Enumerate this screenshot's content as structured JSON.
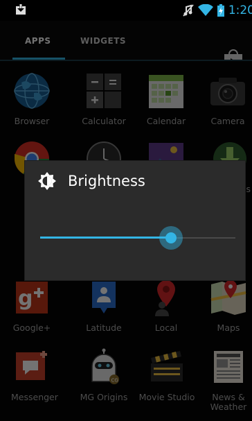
{
  "status_bar": {
    "time": "1:20",
    "icons": [
      "download-icon",
      "mute-icon",
      "wifi-icon",
      "battery-charging-icon"
    ]
  },
  "tabs": {
    "apps": "APPS",
    "widgets": "WIDGETS",
    "store_icon": "play-store-icon"
  },
  "apps": [
    {
      "label": "Browser"
    },
    {
      "label": "Calculator"
    },
    {
      "label": "Calendar"
    },
    {
      "label": "Camera"
    },
    {
      "label": ""
    },
    {
      "label": ""
    },
    {
      "label": ""
    },
    {
      "label": "s"
    },
    {
      "label": "Google+"
    },
    {
      "label": "Latitude"
    },
    {
      "label": "Local"
    },
    {
      "label": "Maps"
    },
    {
      "label": "Messenger"
    },
    {
      "label": "MG Origins"
    },
    {
      "label": "Movie Studio"
    },
    {
      "label": "News &\nWeather"
    }
  ],
  "dialog": {
    "title": "Brightness",
    "icon": "brightness-icon",
    "level": 0.67
  },
  "colors": {
    "accent": "#33b5e5",
    "dialog_bg": "#2b2b2b"
  }
}
